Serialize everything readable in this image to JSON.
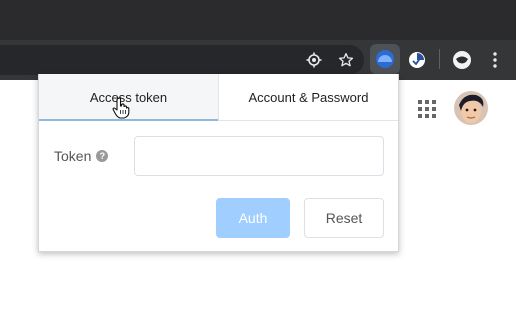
{
  "browser": {
    "toolbar_icons": [
      "location-icon",
      "star-icon",
      "extension-auth-icon",
      "extension-shield-icon",
      "profile-icon",
      "more-menu-icon"
    ]
  },
  "page": {
    "apps_icon": "apps-grid-icon",
    "avatar": "user-avatar"
  },
  "popup": {
    "tabs": [
      {
        "label": "Access token",
        "active": true
      },
      {
        "label": "Account & Password",
        "active": false
      }
    ],
    "token_label": "Token",
    "token_value": "",
    "auth_label": "Auth",
    "reset_label": "Reset"
  },
  "colors": {
    "auth_button": "#a0cfff",
    "tab_underline": "#8fb8df",
    "toolbar": "#353638"
  }
}
